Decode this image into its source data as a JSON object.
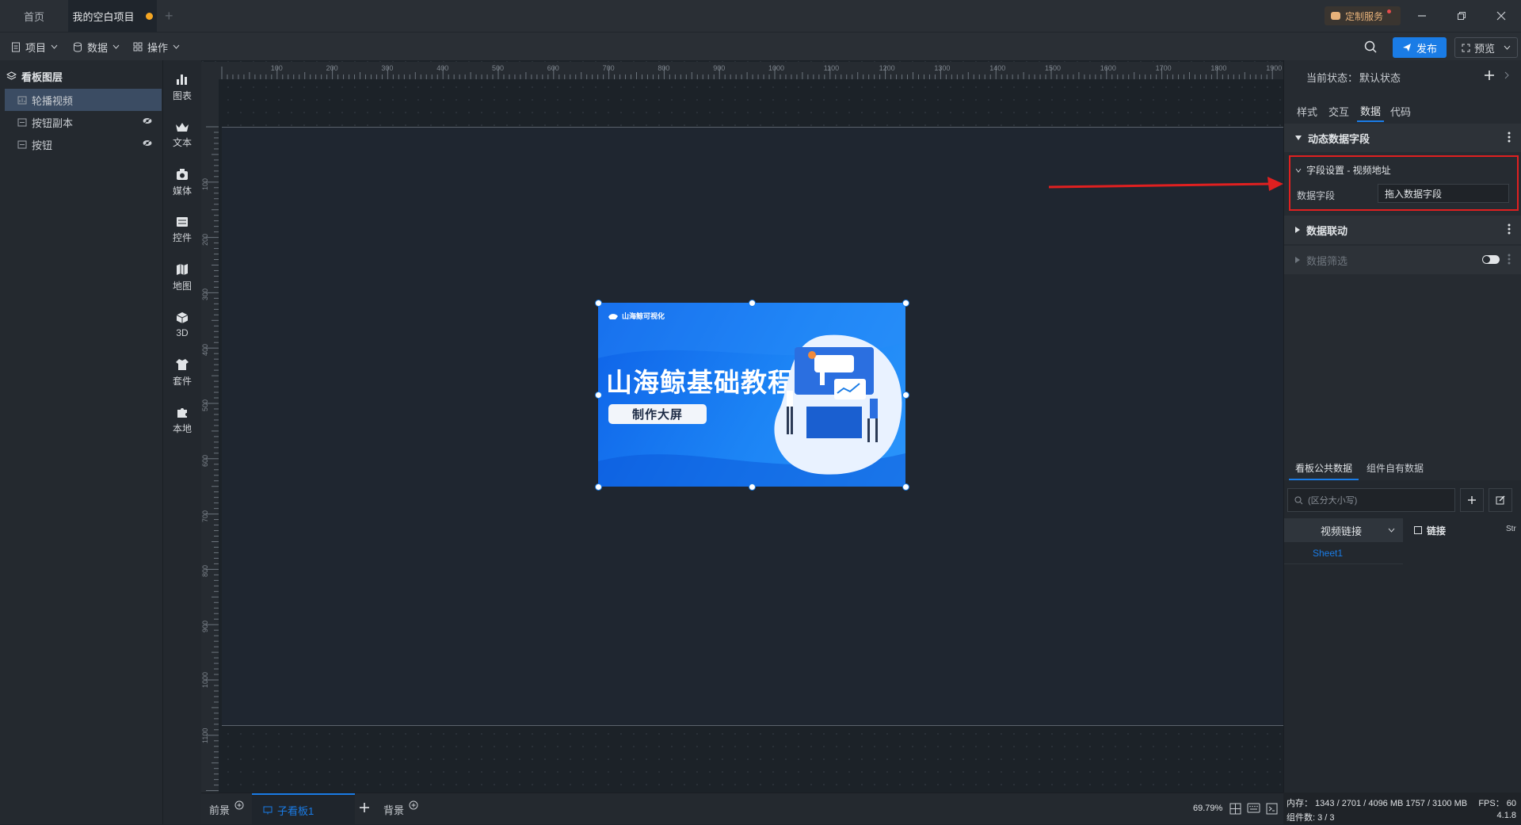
{
  "tabs": {
    "home": "首页",
    "project": "我的空白项目"
  },
  "titlebar": {
    "custom_service": "定制服务"
  },
  "toolbar": {
    "project": "项目",
    "data": "数据",
    "operate": "操作",
    "publish": "发布",
    "preview": "预览"
  },
  "layers": {
    "title": "看板图层",
    "items": [
      {
        "label": "轮播视频"
      },
      {
        "label": "按钮副本"
      },
      {
        "label": "按钮"
      }
    ]
  },
  "components": [
    "图表",
    "文本",
    "媒体",
    "控件",
    "地图",
    "3D",
    "套件",
    "本地"
  ],
  "ruler": {
    "top": [
      "100",
      "200",
      "300",
      "400",
      "500",
      "600",
      "700",
      "800",
      "900",
      "1000",
      "1100",
      "1200",
      "1300",
      "1400",
      "1500",
      "1600",
      "1700",
      "1800",
      "1900"
    ],
    "left": [
      "100",
      "200",
      "300",
      "400",
      "500",
      "600",
      "700",
      "800",
      "900",
      "1000",
      "1100"
    ]
  },
  "banner": {
    "logo": "山海鲸可视化",
    "title": "山海鲸基础教程",
    "subtitle": "制作大屏"
  },
  "bottom": {
    "front": "前景",
    "sub": "子看板1",
    "back": "背景",
    "zoom": "69.79%"
  },
  "panel": {
    "state_label": "当前状态：",
    "state_value": "默认状态",
    "tabs": [
      "样式",
      "交互",
      "数据",
      "代码"
    ],
    "dynamic_field": "动态数据字段",
    "field_setting": "字段设置 - 视频地址",
    "data_field_label": "数据字段",
    "data_field_placeholder": "拖入数据字段",
    "linkage": "数据联动",
    "filter": "数据筛选",
    "data_tabs": [
      "看板公共数据",
      "组件自有数据"
    ],
    "search_placeholder": "(区分大小写)",
    "table_select": "视频链接",
    "column": "链接",
    "column_extra": "Str",
    "sheet": "Sheet1"
  },
  "status": {
    "memory": "内存： 1343 / 2701 / 4096 MB  1757 / 3100 MB",
    "fps": "FPS： 60",
    "count": "组件数: 3 / 3",
    "version": "4.1.8"
  },
  "colors": {
    "accent": "#1a7ce6",
    "highlight_box": "#e02020",
    "arrow": "#e02020"
  }
}
